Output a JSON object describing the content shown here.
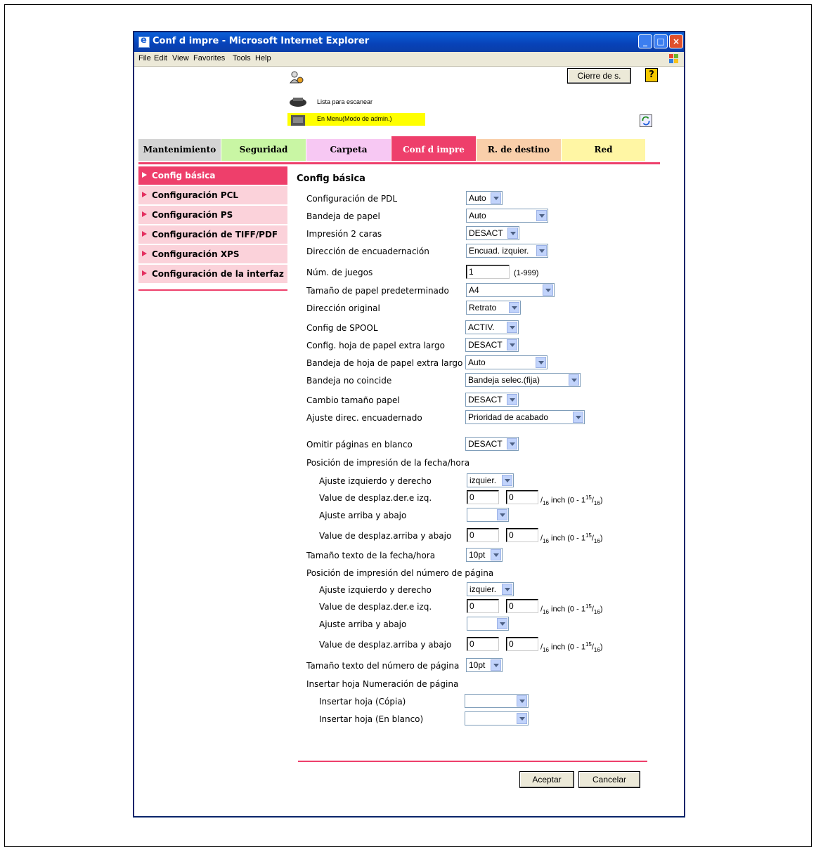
{
  "window": {
    "title": "Conf d impre - Microsoft Internet Explorer",
    "controls": {
      "minimize": "_",
      "maximize": "□",
      "close": "×"
    }
  },
  "menubar": [
    "File",
    "Edit",
    "View",
    "Favorites",
    "Tools",
    "Help"
  ],
  "header": {
    "logout_label": "Cierre de s.",
    "help_label": "?",
    "status_ready": "Lista para escanear",
    "status_mode": "En Menu(Modo de admin.)",
    "status_mode_color": "#ffff00"
  },
  "tabs": [
    {
      "label": "Mantenimiento",
      "color": "#d4d4d4"
    },
    {
      "label": "Seguridad",
      "color": "#c9f6a4"
    },
    {
      "label": "Carpeta",
      "color": "#f7c8f3"
    },
    {
      "label": "Conf d impre",
      "color": "#ee3f6b",
      "active": true
    },
    {
      "label": "R. de destino",
      "color": "#f9cfaa"
    },
    {
      "label": "Red",
      "color": "#fff6a4"
    }
  ],
  "sidebar": [
    {
      "label": "Config básica",
      "active": true
    },
    {
      "label": "Configuración PCL"
    },
    {
      "label": "Configuración PS"
    },
    {
      "label": "Configuración de TIFF/PDF"
    },
    {
      "label": "Configuración XPS"
    },
    {
      "label": "Configuración de la interfaz"
    }
  ],
  "main": {
    "title": "Config básica",
    "fields": {
      "pdl": {
        "label": "Configuración de PDL",
        "value": "Auto"
      },
      "paper_tray": {
        "label": "Bandeja de papel",
        "value": "Auto"
      },
      "duplex": {
        "label": "Impresión 2 caras",
        "value": "DESACT"
      },
      "binding_dir": {
        "label": "Dirección de encuadernación",
        "value": "Encuad. izquier."
      },
      "copies": {
        "label": "Núm. de juegos",
        "value": "1",
        "hint": "(1-999)"
      },
      "paper_size": {
        "label": "Tamaño de papel predeterminado",
        "value": "A4"
      },
      "orientation": {
        "label": "Dirección original",
        "value": "Retrato"
      },
      "spool": {
        "label": "Config de SPOOL",
        "value": "ACTIV."
      },
      "long_paper": {
        "label": "Config. hoja de papel extra largo",
        "value": "DESACT"
      },
      "long_paper_tray": {
        "label": "Bandeja de hoja de papel extra largo",
        "value": "Auto"
      },
      "tray_mismatch": {
        "label": "Bandeja no coincide",
        "value": "Bandeja selec.(fija)"
      },
      "paper_size_change": {
        "label": "Cambio tamaño papel",
        "value": "DESACT"
      },
      "binding_adjust": {
        "label": "Ajuste direc. encuadernado",
        "value": "Prioridad de acabado"
      },
      "skip_blank": {
        "label": "Omitir páginas en blanco",
        "value": "DESACT"
      },
      "date_position_heading": "Posición de impresión de la fecha/hora",
      "date_lr": {
        "label": "Ajuste izquierdo y derecho",
        "value": "izquier."
      },
      "date_lr_shift": {
        "label": "Value de desplaz.der.e izq.",
        "v1": "0",
        "v2": "0"
      },
      "date_tb": {
        "label": "Ajuste arriba y abajo",
        "value": ""
      },
      "date_tb_shift": {
        "label": "Value de desplaz.arriba y abajo",
        "v1": "0",
        "v2": "0"
      },
      "date_font": {
        "label": "Tamaño texto de la fecha/hora",
        "value": "10pt"
      },
      "page_position_heading": "Posición de impresión del número de página",
      "page_lr": {
        "label": "Ajuste izquierdo y derecho",
        "value": "izquier."
      },
      "page_lr_shift": {
        "label": "Value de desplaz.der.e izq.",
        "v1": "0",
        "v2": "0"
      },
      "page_tb": {
        "label": "Ajuste arriba y abajo",
        "value": ""
      },
      "page_tb_shift": {
        "label": "Value de desplaz.arriba y abajo",
        "v1": "0",
        "v2": "0"
      },
      "page_font": {
        "label": "Tamaño texto del número de página",
        "value": "10pt"
      },
      "insert_heading": "Insertar hoja Numeración de página",
      "insert_copy": {
        "label": "Insertar hoja (Cópia)",
        "value": ""
      },
      "insert_blank": {
        "label": "Insertar hoja (En blanco)",
        "value": ""
      }
    },
    "unit": {
      "slash": "/",
      "denominator": "16",
      "text": " inch (0 - 1",
      "sup": "15",
      "sub": "16",
      "close": ")"
    }
  },
  "footer": {
    "ok_label": "Aceptar",
    "cancel_label": "Cancelar"
  }
}
